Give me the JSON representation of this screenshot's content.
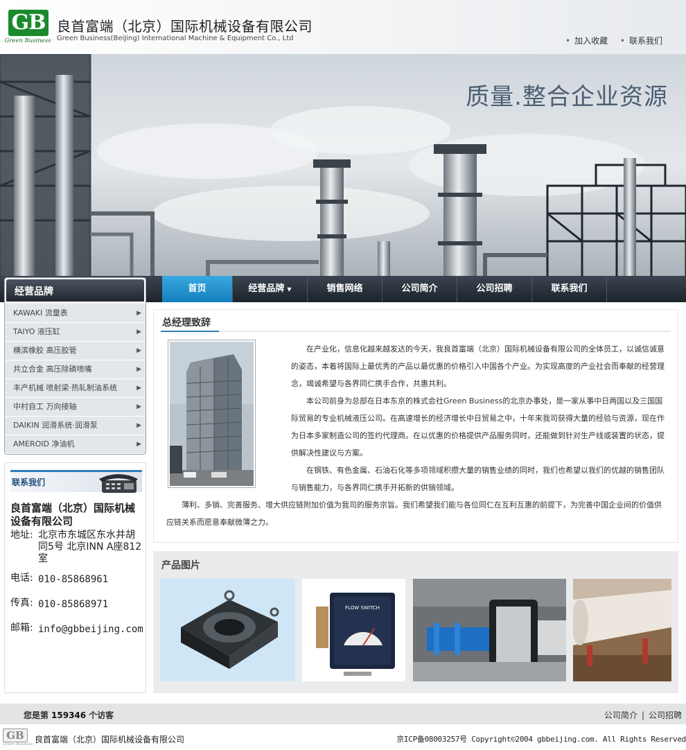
{
  "header": {
    "logo_letters": "GB",
    "logo_subtitle": "Green Business",
    "company_cn": "良首富端（北京）国际机械设备有限公司",
    "company_en": "Green Business(BeiJing) International Machine & Equipment Co., Ltd",
    "links": [
      "加入收藏",
      "联系我们"
    ]
  },
  "banner": {
    "slogan": "质量.整合企业资源"
  },
  "nav": {
    "items": [
      "首页",
      "经营品牌",
      "销售网络",
      "公司简介",
      "公司招聘",
      "联系我们"
    ],
    "active_index": 0
  },
  "brands": {
    "title": "经营品牌",
    "items": [
      "KAWAKI 流量表",
      "TAIYO 液压缸",
      "横滨橡胶 高压胶管",
      "共立合金 高压除磷喷嘴",
      "丰产机械 喷射梁·热轧制油系统",
      "中村自工 万向接轴",
      "DAIKIN 润滑系统·润滑泵",
      "AMEROID 净油机"
    ]
  },
  "contact": {
    "title": "联系我们",
    "company": "良首富端（北京）国际机械设备有限公司",
    "address_label": "地址:",
    "address": "北京市东城区东水井胡同5号 北京INN A座812室",
    "phone_label": "电话:",
    "phone": "010-85868961",
    "fax_label": "传真:",
    "fax": "010-85868971",
    "email_label": "邮箱:",
    "email": "info@gbbeijing.com"
  },
  "article": {
    "title": "总经理致辞",
    "paragraphs": [
      "在产业化，信息化越来越发达的今天，我良首富端（北京）国际机械设备有限公司的全体员工，以诚信诚意的姿态，本着将国际上最优秀的产品以最优惠的价格引入中国各个产业。为实现高度的产业社会而奉献的经营理念，竭诚希望与各界同仁携手合作，共惠共利。",
      "本公司前身为总部在日本东京的株式会社Green Business的北京办事处，是一家从事中日两国以及三国国际贸易的专业机械液压公司。在高速增长的经济增长中日贸易之中，十年来我司获得大量的经验与资源，现在作为日本多家制造公司的签约代理商。在以优惠的价格提供产品服务同时，还能做到针对生产线或装置的状态，提供解决性建议与方案。",
      "在钢铁、有色金属、石油石化等多项领域积攒大量的销售业绩的同时，我们也希望以我们的优越的销售团队与销售能力，与各界同仁携手开拓新的供销领域。",
      "薄利、多销、完善服务、增大供应链附加价值为我司的服务宗旨。我们希望我们能与各位同仁在互利互惠的前提下，为完善中国企业间的价值供应链关系而愿意奉献微薄之力。"
    ]
  },
  "products": {
    "title": "产品图片",
    "gauge_label": "FLOW SWITCH"
  },
  "footer": {
    "visitor_prefix": "您是第",
    "visitor_count": "159346",
    "visitor_suffix": "个访客",
    "links": [
      "公司简介",
      "公司招聘"
    ],
    "separator": "|",
    "logo_letters": "GB",
    "logo_subtitle": "Green Business",
    "company": "良首富端（北京）国际机械设备有限公司",
    "copyright": "京ICP备08003257号 Copyright©2004 gbbeijing.com. All Rights Reserved"
  },
  "colors": {
    "logo_green": "#1a8a2c",
    "nav_active": "#1f8fce",
    "nav_bg": "#2a323b",
    "accent_blue": "#2f7fb8"
  }
}
